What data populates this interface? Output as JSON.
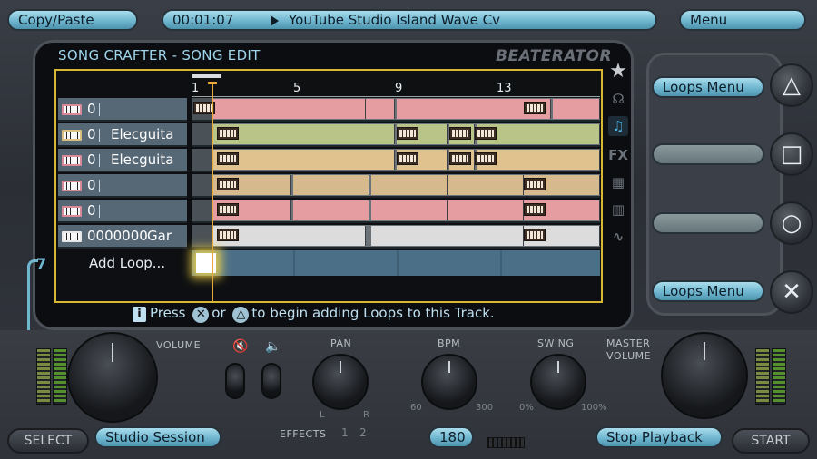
{
  "top_bar": {
    "copy_paste": "Copy/Paste",
    "time": "00:01:07",
    "song_title": "YouTube Studio Island Wave Cv",
    "menu": "Menu"
  },
  "screen": {
    "header": "SONG CRAFTER - SONG EDIT",
    "brand": "BEATERATOR",
    "ruler_ticks": [
      "1",
      "5",
      "9",
      "13"
    ],
    "side_icons": [
      "FX"
    ]
  },
  "tracks": [
    {
      "num": "0",
      "name": "",
      "icon_color": "#d98a98",
      "clip_color": "#e59da1"
    },
    {
      "num": "0",
      "name": "Elecguita",
      "icon_color": "#d9c080",
      "clip_color": "#b9c488"
    },
    {
      "num": "0",
      "name": "Elecguita",
      "icon_color": "#d98a98",
      "clip_color": "#e0c28f"
    },
    {
      "num": "0",
      "name": "",
      "icon_color": "#d98a98",
      "clip_color": "#d6b98c"
    },
    {
      "num": "0",
      "name": "",
      "icon_color": "#d98a98",
      "clip_color": "#e59da1"
    },
    {
      "num": "0000000",
      "name": "Gar",
      "icon_color": "#e8e8e8",
      "clip_color": "#dcdcdc"
    }
  ],
  "add_loop": "Add Loop...",
  "loop_count": "7",
  "hint": {
    "press": "Press",
    "or": "or",
    "rest": "to begin adding Loops to this Track."
  },
  "right_panel": {
    "loops_menu_top": "Loops Menu",
    "loops_menu_bottom": "Loops Menu"
  },
  "deck": {
    "volume": "VOLUME",
    "pan": "PAN",
    "pan_l": "L",
    "pan_r": "R",
    "bpm": "BPM",
    "bpm_min": "60",
    "bpm_max": "300",
    "swing": "SWING",
    "swing_min": "0%",
    "swing_max": "100%",
    "master_volume_1": "MASTER",
    "master_volume_2": "VOLUME",
    "effects": "EFFECTS",
    "fx1": "1",
    "fx2": "2"
  },
  "bottom_bar": {
    "select": "SELECT",
    "studio_session": "Studio Session",
    "bpm_value": "180",
    "stop_playback": "Stop Playback",
    "start": "START"
  }
}
